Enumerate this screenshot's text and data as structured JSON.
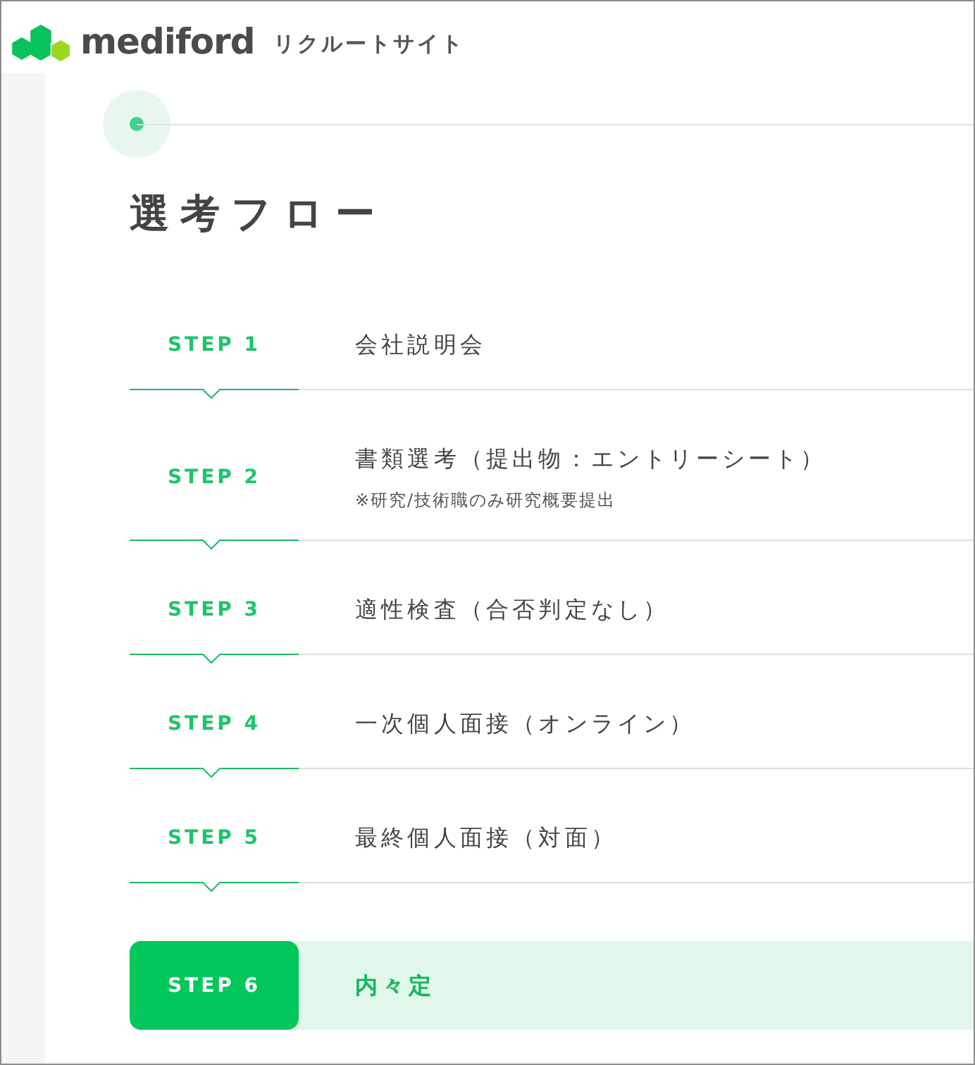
{
  "header": {
    "logo_text": "mediford",
    "site_name": "リクルートサイト"
  },
  "title": "選考フロー",
  "steps": [
    {
      "kind": "step",
      "label": "STEP 1",
      "title": "会社説明会"
    },
    {
      "kind": "step",
      "label": "STEP 2",
      "title": "書類選考（提出物：エントリーシート）",
      "note": "※研究/技術職のみ研究概要提出"
    },
    {
      "kind": "step",
      "label": "STEP 3",
      "title": "適性検査（合否判定なし）"
    },
    {
      "kind": "step",
      "label": "STEP 4",
      "title": "一次個人面接（オンライン）"
    },
    {
      "kind": "step",
      "label": "STEP 5",
      "title": "最終個人面接（対面）"
    },
    {
      "kind": "final",
      "label": "STEP 6",
      "title": "内々定"
    }
  ]
}
